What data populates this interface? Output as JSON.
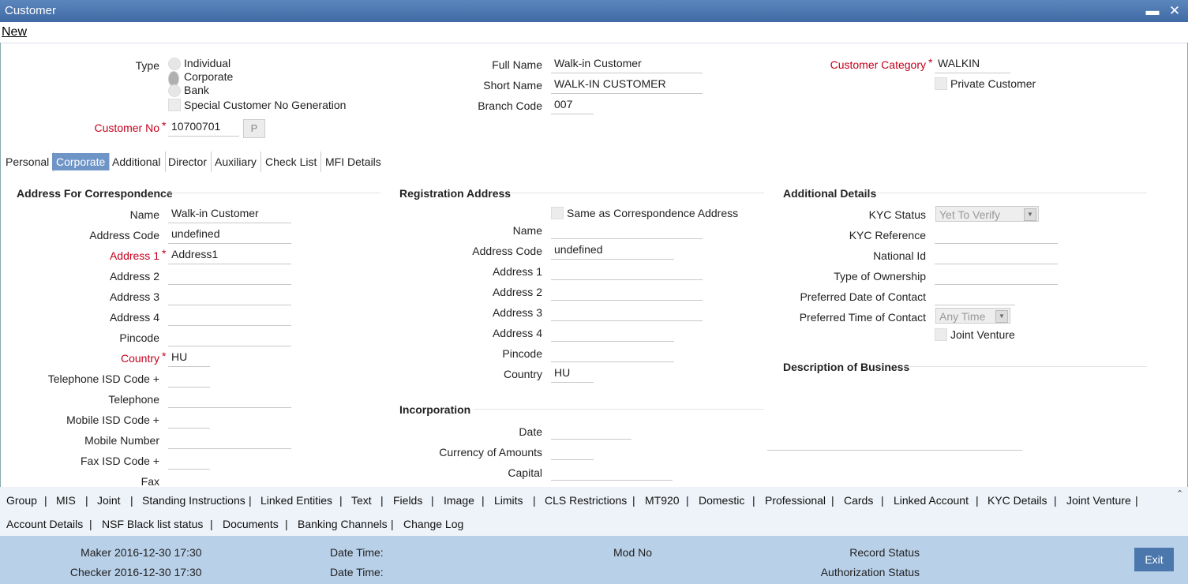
{
  "window": {
    "title": "Customer"
  },
  "menu": {
    "new": "New"
  },
  "header": {
    "type_label": "Type",
    "type_options": [
      "Individual",
      "Corporate",
      "Bank"
    ],
    "special_no": "Special Customer No Generation",
    "customer_no_label": "Customer No",
    "customer_no": "10700701",
    "p_button": "P",
    "full_name_label": "Full Name",
    "full_name": "Walk-in Customer",
    "short_name_label": "Short Name",
    "short_name": "WALK-IN CUSTOMER",
    "branch_code_label": "Branch Code",
    "branch_code": "007",
    "customer_category_label": "Customer Category",
    "customer_category": "WALKIN",
    "private_customer": "Private Customer"
  },
  "tabs": [
    "Personal",
    "Corporate",
    "Additional",
    "Director",
    "Auxiliary",
    "Check List",
    "MFI Details"
  ],
  "correspondence": {
    "title": "Address For Correspondence",
    "name_label": "Name",
    "name": "Walk-in Customer",
    "address_code_label": "Address Code",
    "address_code": "undefined",
    "address1_label": "Address 1",
    "address1": "Address1",
    "address2_label": "Address 2",
    "address3_label": "Address 3",
    "address4_label": "Address 4",
    "pincode_label": "Pincode",
    "country_label": "Country",
    "country": "HU",
    "tel_isd_label": "Telephone ISD Code +",
    "telephone_label": "Telephone",
    "mobile_isd_label": "Mobile ISD Code +",
    "mobile_label": "Mobile Number",
    "fax_isd_label": "Fax ISD Code +",
    "fax_label": "Fax"
  },
  "registration": {
    "title": "Registration Address",
    "same_as": "Same as Correspondence Address",
    "name_label": "Name",
    "address_code_label": "Address Code",
    "address_code": "undefined",
    "address1_label": "Address 1",
    "address2_label": "Address 2",
    "address3_label": "Address 3",
    "address4_label": "Address 4",
    "pincode_label": "Pincode",
    "country_label": "Country",
    "country": "HU"
  },
  "incorporation": {
    "title": "Incorporation",
    "date_label": "Date",
    "currency_label": "Currency of Amounts",
    "capital_label": "Capital"
  },
  "additional": {
    "title": "Additional Details",
    "kyc_status_label": "KYC Status",
    "kyc_status": "Yet To Verify",
    "kyc_ref_label": "KYC Reference",
    "national_id_label": "National Id",
    "ownership_label": "Type of Ownership",
    "pref_date_label": "Preferred Date of Contact",
    "pref_time_label": "Preferred Time of Contact",
    "pref_time": "Any Time",
    "joint_venture": "Joint Venture",
    "business_title": "Description of Business"
  },
  "bottom_links_row1": [
    "Group",
    "MIS",
    "Joint",
    "Standing Instructions",
    "Linked Entities",
    "Text",
    "Fields",
    "Image",
    "Limits",
    "CLS Restrictions",
    "MT920",
    "Domestic",
    "Professional",
    "Cards",
    "Linked Account",
    "KYC Details",
    "Joint Venture"
  ],
  "bottom_links_row2": [
    "Account Details",
    "NSF Black list status",
    "Documents",
    "Banking Channels",
    "Change Log"
  ],
  "footer": {
    "maker_label": "Maker",
    "maker": "2016-12-30 17:30",
    "checker_label": "Checker",
    "checker": "2016-12-30 17:30",
    "date_time_label": "Date Time:",
    "mod_no_label": "Mod No",
    "record_status_label": "Record Status",
    "auth_status_label": "Authorization Status",
    "exit": "Exit"
  }
}
